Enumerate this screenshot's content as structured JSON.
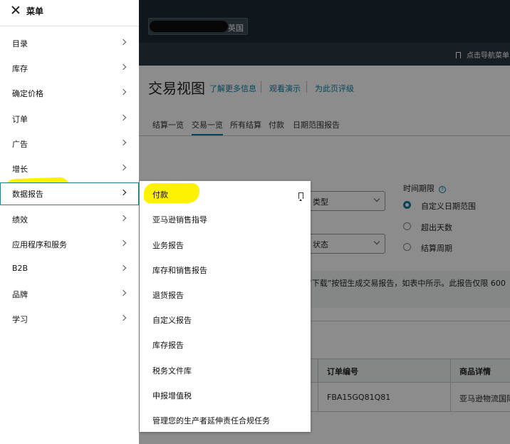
{
  "background": {
    "region": "英国",
    "nav_hint": "点击导航菜单",
    "page_title": "交易视图",
    "title_links": [
      "了解更多信息",
      "观看演示",
      "为此页评级"
    ],
    "tabs": [
      "结算一览",
      "交易一览",
      "所有结算",
      "付款",
      "日期范围报告"
    ],
    "active_tab": "交易一览",
    "select_type": "类型",
    "select_status": "状态",
    "time_period_label": "时间期限",
    "radio_options": [
      "自定义日期范围",
      "超出天数",
      "结算周期"
    ],
    "radio_selected": "自定义日期范围",
    "info_text": "“下载”按钮生成交易报告，如表中所示。此报告仅限 600",
    "table": {
      "headers": [
        "订单编号",
        "商品详情"
      ],
      "row": [
        "FBA15GQ81Q81",
        "亚马逊物流国际"
      ]
    }
  },
  "menu": {
    "title": "菜单",
    "items": [
      {
        "label": "目录"
      },
      {
        "label": "库存"
      },
      {
        "label": "确定价格"
      },
      {
        "label": "订单"
      },
      {
        "label": "广告"
      },
      {
        "label": "增长"
      },
      {
        "label": "数据报告"
      },
      {
        "label": "绩效"
      },
      {
        "label": "应用程序和服务"
      },
      {
        "label": "B2B"
      },
      {
        "label": "品牌"
      },
      {
        "label": "学习"
      }
    ],
    "active": "数据报告"
  },
  "submenu": {
    "items": [
      {
        "label": "付款"
      },
      {
        "label": "亚马逊销售指导"
      },
      {
        "label": "业务报告"
      },
      {
        "label": "库存和销售报告"
      },
      {
        "label": "退货报告"
      },
      {
        "label": "自定义报告"
      },
      {
        "label": "库存报告"
      },
      {
        "label": "税务文件库"
      },
      {
        "label": "申报增值税"
      },
      {
        "label": "管理您的生产者延伸责任合规任务"
      }
    ]
  },
  "colors": {
    "highlight": "#fff200",
    "accent": "#0a7ea4",
    "active_border": "#2a7f8c",
    "topbar": "#1d2b33"
  },
  "icons": [
    "close-icon",
    "chevron-right-icon",
    "bookmark-icon",
    "help-icon",
    "chevron-down-icon"
  ]
}
